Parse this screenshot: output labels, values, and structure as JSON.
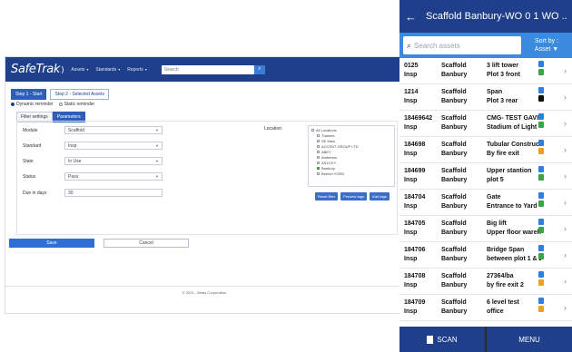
{
  "desktop": {
    "brand": "SafeTrak",
    "nav": [
      "Assets",
      "Standards",
      "Reports"
    ],
    "search_placeholder": "Search",
    "steps": [
      "Step 1 - Start",
      "Step 2 - Selected Assets"
    ],
    "radios": [
      "Dynamic reminder",
      "Static reminder"
    ],
    "subtabs": [
      "Filter settings",
      "Parameters"
    ],
    "form": {
      "rows": [
        {
          "label": "Module",
          "value": "Scaffold"
        },
        {
          "label": "Standard",
          "value": "Insp"
        },
        {
          "label": "State",
          "value": "In Use"
        },
        {
          "label": "Status",
          "value": "Pass"
        }
      ],
      "due_label": "Due in days",
      "due_value": "30",
      "location_label": "Location",
      "tree": [
        {
          "label": "All Locations",
          "child": false,
          "checked": false
        },
        {
          "label": "Thames",
          "child": true,
          "checked": false
        },
        {
          "label": "SE Main",
          "child": true,
          "checked": false
        },
        {
          "label": "ACCENT GROUP LTD",
          "child": true,
          "checked": false
        },
        {
          "label": "ABEY",
          "child": true,
          "checked": false
        },
        {
          "label": "Amberton",
          "child": true,
          "checked": false
        },
        {
          "label": "AS13 EY",
          "child": true,
          "checked": false
        },
        {
          "label": "Banbury",
          "child": true,
          "checked": true
        },
        {
          "label": "Beeton YORD",
          "child": true,
          "checked": false
        }
      ],
      "tree_buttons": [
        "Reset filter",
        "Preview tags",
        "Add tags"
      ]
    },
    "save_label": "Save",
    "cancel_label": "Cancel",
    "footer": "© 2021 - Brials Corporation"
  },
  "phone": {
    "title": "Scaffold Banbury-WO 0 1 WO ...",
    "search_placeholder": "Search assets",
    "sort_label": "Sort by :",
    "sort_value": "Asset ▼",
    "rows": [
      {
        "id": "0125",
        "type": "Scaffold",
        "site": "Banbury",
        "kind": "Insp",
        "name": "3 lift tower",
        "loc": "Plot 3 front",
        "b1": "#2f7fe0",
        "b2": "#3ca34a"
      },
      {
        "id": "1214",
        "type": "Scaffold",
        "site": "Banbury",
        "kind": "Insp",
        "name": "Span",
        "loc": "Plot 3 rear",
        "b1": "#2f7fe0",
        "b2": "#111111"
      },
      {
        "id": "18469642",
        "type": "Scaffold",
        "site": "Banbury",
        "kind": "Insp",
        "name": "CMG- TEST GAVI...",
        "loc": "Stadium of Light",
        "b1": "#2f7fe0",
        "b2": "#3ca34a"
      },
      {
        "id": "184698",
        "type": "Scaffold",
        "site": "Banbury",
        "kind": "Insp",
        "name": "Tubular Construct...",
        "loc": "By fire exit",
        "b1": "#2f7fe0",
        "b2": "#f0a020"
      },
      {
        "id": "184699",
        "type": "Scaffold",
        "site": "Banbury",
        "kind": "Insp",
        "name": "Upper stantion",
        "loc": "plot 5",
        "b1": "#2f7fe0",
        "b2": "#3ca34a"
      },
      {
        "id": "184704",
        "type": "Scaffold",
        "site": "Banbury",
        "kind": "Insp",
        "name": "Gate",
        "loc": "Entrance to Yard",
        "b1": "#2f7fe0",
        "b2": "#3ca34a"
      },
      {
        "id": "184705",
        "type": "Scaffold",
        "site": "Banbury",
        "kind": "Insp",
        "name": "Big lift",
        "loc": "Upper floor wareh...",
        "b1": "#2f7fe0",
        "b2": "#3ca34a"
      },
      {
        "id": "184706",
        "type": "Scaffold",
        "site": "Banbury",
        "kind": "Insp",
        "name": "Bridge Span",
        "loc": "between plot 1 & 2",
        "b1": "#2f7fe0",
        "b2": "#3ca34a"
      },
      {
        "id": "184708",
        "type": "Scaffold",
        "site": "Banbury",
        "kind": "Insp",
        "name": "27364/ba",
        "loc": "by fire exit 2",
        "b1": "#2f7fe0",
        "b2": "#f0a020"
      },
      {
        "id": "184709",
        "type": "Scaffold",
        "site": "Banbury",
        "kind": "Insp",
        "name": "6 level test",
        "loc": "office",
        "b1": "#2f7fe0",
        "b2": "#f0a020"
      }
    ],
    "scan_label": "SCAN",
    "menu_label": "MENU"
  }
}
